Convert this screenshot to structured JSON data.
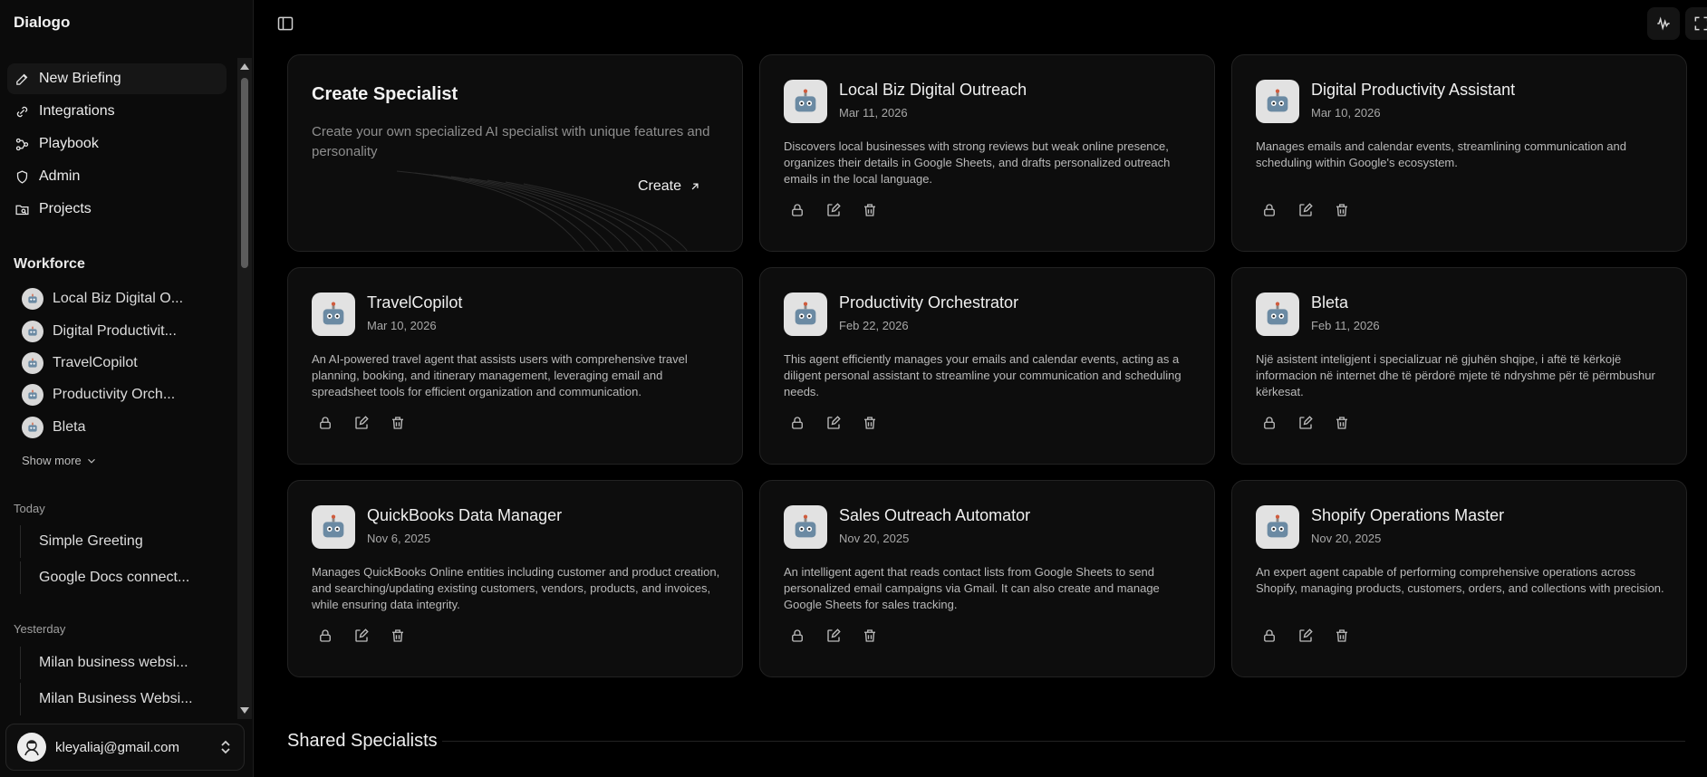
{
  "app": {
    "brand": "Dialogo"
  },
  "sidebar": {
    "nav": [
      {
        "label": "New Briefing",
        "icon": "edit-icon"
      },
      {
        "label": "Integrations",
        "icon": "link-icon"
      },
      {
        "label": "Playbook",
        "icon": "workflow-icon"
      },
      {
        "label": "Admin",
        "icon": "shield-icon"
      },
      {
        "label": "Projects",
        "icon": "folder-search-icon"
      }
    ],
    "workforce_title": "Workforce",
    "workforce": [
      {
        "label": "Local Biz Digital O..."
      },
      {
        "label": "Digital Productivit..."
      },
      {
        "label": "TravelCopilot"
      },
      {
        "label": "Productivity Orch..."
      },
      {
        "label": "Bleta"
      }
    ],
    "show_more": "Show more",
    "groups": [
      {
        "label": "Today",
        "chats": [
          "Simple Greeting",
          "Google Docs connect..."
        ]
      },
      {
        "label": "Yesterday",
        "chats": [
          "Milan business websi...",
          "Milan Business Websi..."
        ]
      }
    ],
    "user": {
      "email": "kleyaliaj@gmail.com"
    }
  },
  "create_card": {
    "title": "Create Specialist",
    "description": "Create your own specialized AI specialist with unique features and personality",
    "button": "Create"
  },
  "specialists": [
    {
      "name": "Local Biz Digital Outreach",
      "date": "Mar 11, 2026",
      "description": "Discovers local businesses with strong reviews but weak online presence, organizes their details in Google Sheets, and drafts personalized outreach emails in the local language."
    },
    {
      "name": "Digital Productivity Assistant",
      "date": "Mar 10, 2026",
      "description": "Manages emails and calendar events, streamlining communication and scheduling within Google's ecosystem."
    },
    {
      "name": "TravelCopilot",
      "date": "Mar 10, 2026",
      "description": "An AI-powered travel agent that assists users with comprehensive travel planning, booking, and itinerary management, leveraging email and spreadsheet tools for efficient organization and communication."
    },
    {
      "name": "Productivity Orchestrator",
      "date": "Feb 22, 2026",
      "description": "This agent efficiently manages your emails and calendar events, acting as a diligent personal assistant to streamline your communication and scheduling needs."
    },
    {
      "name": "Bleta",
      "date": "Feb 11, 2026",
      "description": "Një asistent inteligjent i specializuar në gjuhën shqipe, i aftë të kërkojë informacion në internet dhe të përdorë mjete të ndryshme për të përmbushur kërkesat."
    },
    {
      "name": "QuickBooks Data Manager",
      "date": "Nov 6, 2025",
      "description": "Manages QuickBooks Online entities including customer and product creation, and searching/updating existing customers, vendors, products, and invoices, while ensuring data integrity."
    },
    {
      "name": "Sales Outreach Automator",
      "date": "Nov 20, 2025",
      "description": "An intelligent agent that reads contact lists from Google Sheets to send personalized email campaigns via Gmail. It can also create and manage Google Sheets for sales tracking."
    },
    {
      "name": "Shopify Operations Master",
      "date": "Nov 20, 2025",
      "description": "An expert agent capable of performing comprehensive operations across Shopify, managing products, customers, orders, and collections with precision."
    }
  ],
  "shared_title": "Shared Specialists"
}
